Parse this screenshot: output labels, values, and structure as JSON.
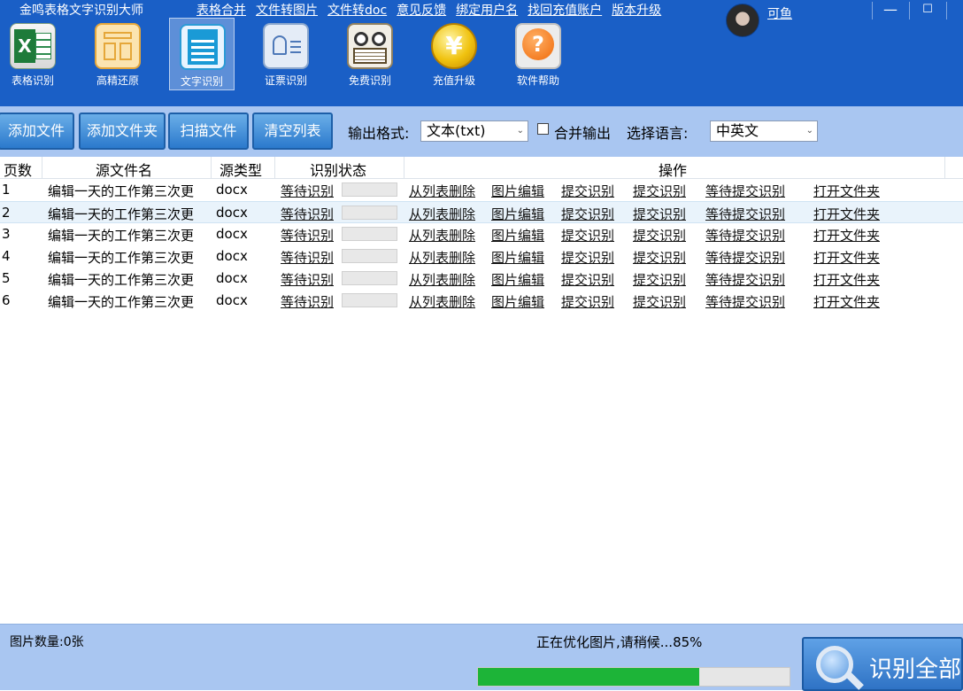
{
  "app": {
    "title": "金鸣表格文字识别大师",
    "username": "可鱼"
  },
  "top_links": [
    "表格合并",
    "文件转图片",
    "文件转doc",
    "意见反馈",
    "绑定用户名",
    "找回充值账户",
    "版本升级"
  ],
  "window_controls": {
    "minimize": "—",
    "maximize": "☐"
  },
  "toolbar": [
    {
      "label": "表格识别",
      "icon": "excel-icon"
    },
    {
      "label": "高精还原",
      "icon": "restore-layout-icon"
    },
    {
      "label": "文字识别",
      "icon": "document-text-icon",
      "active": true
    },
    {
      "label": "证票识别",
      "icon": "id-card-icon"
    },
    {
      "label": "免费识别",
      "icon": "book-glasses-icon"
    },
    {
      "label": "充值升级",
      "icon": "yuan-coin-icon"
    },
    {
      "label": "软件帮助",
      "icon": "help-icon"
    }
  ],
  "coin_glyph": "¥",
  "help_glyph": "?",
  "excel_glyph": "X",
  "actions": {
    "add_file": "添加文件",
    "add_folder": "添加文件夹",
    "scan_file": "扫描文件",
    "clear_list": "清空列表",
    "output_format_label": "输出格式:",
    "output_format_value": "文本(txt)",
    "merge_output_label": "合并输出",
    "merge_output_checked": false,
    "language_label": "选择语言:",
    "language_value": "中英文"
  },
  "table": {
    "columns": [
      "页数",
      "源文件名",
      "源类型",
      "识别状态",
      "操作"
    ],
    "op_links": [
      "从列表删除",
      "图片编辑",
      "提交识别",
      "提交识别",
      "等待提交识别",
      "打开文件夹"
    ],
    "rows": [
      {
        "page": "1",
        "name": "编辑一天的工作第三次更",
        "type": "docx",
        "status": "等待识别",
        "progress": 0
      },
      {
        "page": "2",
        "name": "编辑一天的工作第三次更",
        "type": "docx",
        "status": "等待识别",
        "progress": 0
      },
      {
        "page": "3",
        "name": "编辑一天的工作第三次更",
        "type": "docx",
        "status": "等待识别",
        "progress": 0
      },
      {
        "page": "4",
        "name": "编辑一天的工作第三次更",
        "type": "docx",
        "status": "等待识别",
        "progress": 0
      },
      {
        "page": "5",
        "name": "编辑一天的工作第三次更",
        "type": "docx",
        "status": "等待识别",
        "progress": 0
      },
      {
        "page": "6",
        "name": "编辑一天的工作第三次更",
        "type": "docx",
        "status": "等待识别",
        "progress": 0
      }
    ]
  },
  "status": {
    "image_count": "图片数量:0张",
    "message": "正在优化图片,请稍候...85%",
    "progress": 0.71,
    "recognize_all": "识别全部"
  },
  "colors": {
    "header": "#1a5fc6",
    "bar": "#a9c6f1",
    "progress": "#1db438"
  }
}
